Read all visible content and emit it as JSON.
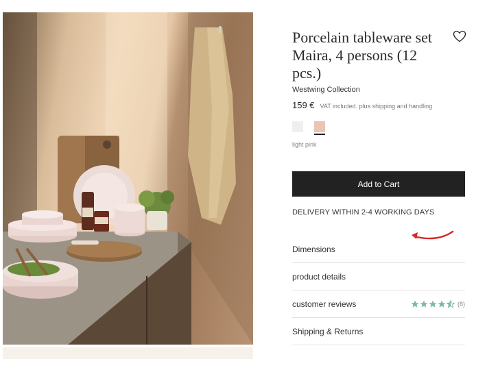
{
  "product": {
    "title": "Porcelain tableware set Maira, 4 persons (12 pcs.)",
    "brand": "Westwing Collection",
    "price": "159 €",
    "vat_note": "VAT included. plus shipping and handling",
    "selected_color": "light pink",
    "swatches": [
      {
        "name": "light grey",
        "color": "#efefef",
        "selected": false
      },
      {
        "name": "light pink",
        "color": "#e8c6b6",
        "selected": true
      }
    ]
  },
  "cta": {
    "add_to_cart": "Add to Cart"
  },
  "delivery": {
    "text": "DELIVERY WITHIN 2-4 WORKING DAYS",
    "arrow_color": "#d62828"
  },
  "accordion": {
    "items": [
      {
        "label": "Dimensions"
      },
      {
        "label": "product details"
      },
      {
        "label": "customer reviews",
        "rating": 4.5,
        "rating_count": "(8)",
        "star_color": "#7db8a2"
      },
      {
        "label": "Shipping & Returns"
      }
    ]
  },
  "icons": {
    "wishlist": "heart-icon",
    "rating": "star-icon"
  }
}
